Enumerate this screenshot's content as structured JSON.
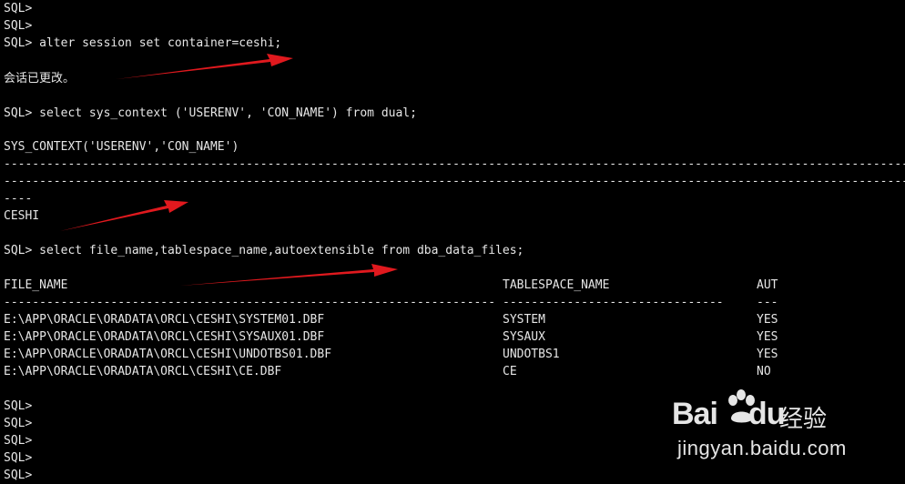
{
  "terminal": {
    "prompts_top": [
      "SQL>",
      "SQL>"
    ],
    "alter_cmd": "SQL> alter session set container=ceshi;",
    "alter_result": "会话已更改。",
    "context_cmd": "SQL> select sys_context ('USERENV', 'CON_NAME') from dual;",
    "context_header": "SYS_CONTEXT('USERENV','CON_NAME')",
    "context_dashes_1": "--------------------------------------------------------------------------------------------------------------------------------------------------------------",
    "context_dashes_2": "--------------------------------------------------------------------------------------------------------------------------------------------------------------",
    "context_dashes_3": "----",
    "context_value": "CESHI",
    "files_cmd": "SQL> select file_name,tablespace_name,autoextensible from dba_data_files;",
    "table": {
      "headers": [
        "FILE_NAME",
        "TABLESPACE_NAME",
        "AUT"
      ],
      "separators": [
        "------------------------------------------------------------------------",
        "-------------------------------",
        "---"
      ],
      "rows": [
        [
          "E:\\APP\\ORACLE\\ORADATA\\ORCL\\CESHI\\SYSTEM01.DBF",
          "SYSTEM",
          "YES"
        ],
        [
          "E:\\APP\\ORACLE\\ORADATA\\ORCL\\CESHI\\SYSAUX01.DBF",
          "SYSAUX",
          "YES"
        ],
        [
          "E:\\APP\\ORACLE\\ORADATA\\ORCL\\CESHI\\UNDOTBS01.DBF",
          "UNDOTBS1",
          "YES"
        ],
        [
          "E:\\APP\\ORACLE\\ORADATA\\ORCL\\CESHI\\CE.DBF",
          "CE",
          "NO"
        ]
      ]
    },
    "prompts_bottom": [
      "SQL>",
      "SQL>",
      "SQL>",
      "SQL>",
      "SQL>"
    ]
  },
  "annotation": {
    "arrow_color": "#e0191e"
  },
  "watermark": {
    "logo_text": "Bai",
    "logo_text_2": "du",
    "cn_text": "经验",
    "url_text": "jingyan.baidu.com"
  }
}
